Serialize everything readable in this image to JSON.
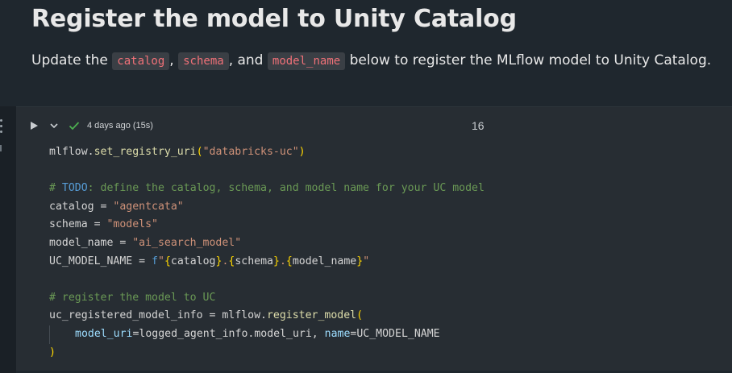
{
  "markdown": {
    "title": "Register the model to Unity Catalog",
    "para": {
      "text_before": "Update the ",
      "code1": "catalog",
      "sep1": ", ",
      "code2": "schema",
      "sep2": ", and ",
      "code3": "model_name",
      "text_after": " below to register the MLflow model to Unity Catalog."
    }
  },
  "cell": {
    "status": "4 days ago (15s)",
    "number": "16",
    "icons": {
      "run": "play-icon",
      "collapse": "chevron-down-icon",
      "status": "check-icon",
      "menu": "kebab-menu-icon"
    },
    "code": {
      "l1": {
        "a": "mlflow.",
        "b": "set_registry_uri",
        "c": "(",
        "d": "\"databricks-uc\"",
        "e": ")"
      },
      "l3": {
        "a": "# ",
        "b": "TODO",
        "c": ": define the catalog, schema, and model name for your UC model"
      },
      "l4": {
        "a": "catalog = ",
        "b": "\"agentcata\""
      },
      "l5": {
        "a": "schema = ",
        "b": "\"models\""
      },
      "l6": {
        "a": "model_name = ",
        "b": "\"ai_search_model\""
      },
      "l7": {
        "a": "UC_MODEL_NAME = ",
        "b": "f",
        "c": "\"",
        "d": "{",
        "e": "catalog",
        "f": "}",
        "g": ".",
        "h": "{",
        "i": "schema",
        "j": "}",
        "k": ".",
        "l": "{",
        "m": "model_name",
        "n": "}",
        "o": "\""
      },
      "l9": {
        "a": "# register the model to UC"
      },
      "l10": {
        "a": "uc_registered_model_info = mlflow.",
        "b": "register_model",
        "c": "("
      },
      "l11": {
        "a": "model_uri",
        "b": "=logged_agent_info.model_uri, ",
        "c": "name",
        "d": "=UC_MODEL_NAME"
      },
      "l12": {
        "a": ")"
      }
    }
  },
  "colors": {
    "background": "#1f272e",
    "cell_background": "#272d33",
    "inline_code": "#f07178",
    "success_check": "#4caf50"
  }
}
